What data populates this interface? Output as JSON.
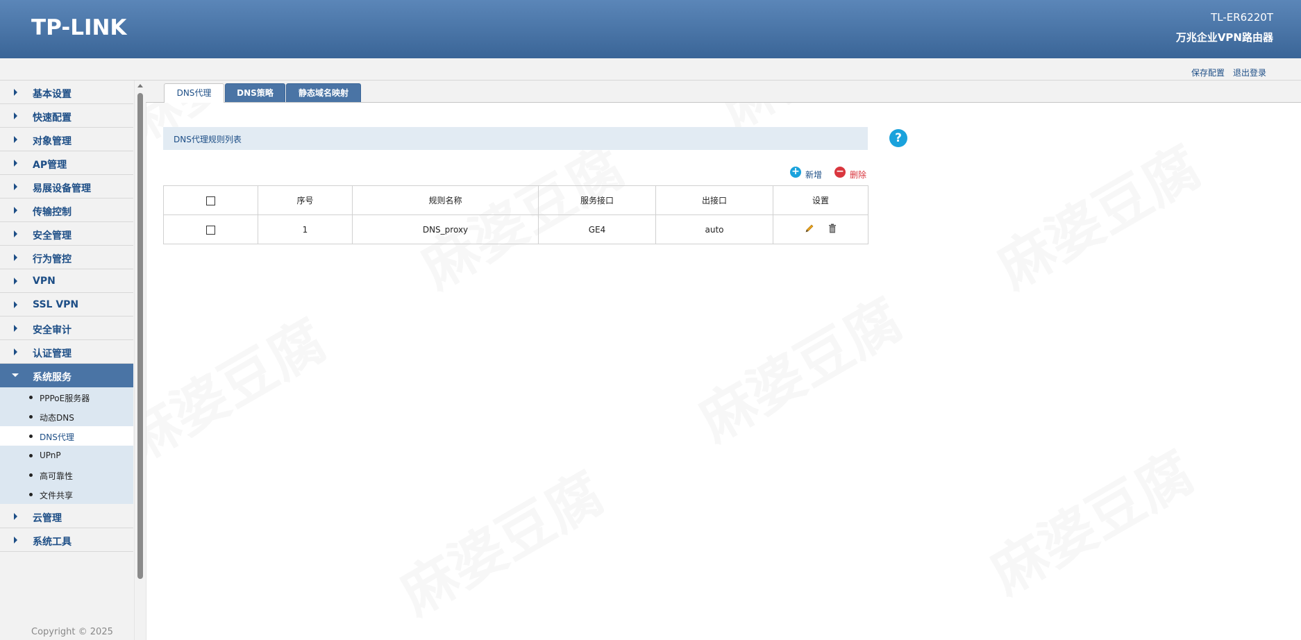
{
  "header": {
    "logo": "TP-LINK",
    "model": "TL-ER6220T",
    "product": "万兆企业VPN路由器"
  },
  "topbar": {
    "save_config": "保存配置",
    "logout": "退出登录"
  },
  "sidebar": {
    "items": [
      {
        "label": "基本设置"
      },
      {
        "label": "快速配置"
      },
      {
        "label": "对象管理"
      },
      {
        "label": "AP管理"
      },
      {
        "label": "易展设备管理"
      },
      {
        "label": "传输控制"
      },
      {
        "label": "安全管理"
      },
      {
        "label": "行为管控"
      },
      {
        "label": "VPN"
      },
      {
        "label": "SSL VPN"
      },
      {
        "label": "安全审计"
      },
      {
        "label": "认证管理"
      },
      {
        "label": "系统服务"
      },
      {
        "label": "云管理"
      },
      {
        "label": "系统工具"
      }
    ],
    "sub_items": [
      {
        "label": "PPPoE服务器"
      },
      {
        "label": "动态DNS"
      },
      {
        "label": "DNS代理"
      },
      {
        "label": "UPnP"
      },
      {
        "label": "高可靠性"
      },
      {
        "label": "文件共享"
      }
    ],
    "copyright": "Copyright © 2025"
  },
  "tabs": [
    {
      "label": "DNS代理"
    },
    {
      "label": "DNS策略"
    },
    {
      "label": "静态域名映射"
    }
  ],
  "section": {
    "title": "DNS代理规则列表"
  },
  "actions": {
    "add": "新增",
    "delete": "删除"
  },
  "table": {
    "headers": [
      "序号",
      "规则名称",
      "服务接口",
      "出接口",
      "设置"
    ],
    "rows": [
      {
        "index": "1",
        "name": "DNS_proxy",
        "service_if": "GE4",
        "out_if": "auto"
      }
    ]
  },
  "watermark": "麻婆豆腐",
  "colors": {
    "header_blue": "#3a6597",
    "link_blue": "#1d4e86",
    "help_blue": "#1aa2dc",
    "add_blue": "#1aa2dc",
    "delete_red": "#d9363e"
  },
  "icons": {
    "help": "help-icon",
    "add": "plus-circle-icon",
    "delete": "minus-circle-icon",
    "edit": "pencil-icon",
    "trash": "trash-icon"
  }
}
